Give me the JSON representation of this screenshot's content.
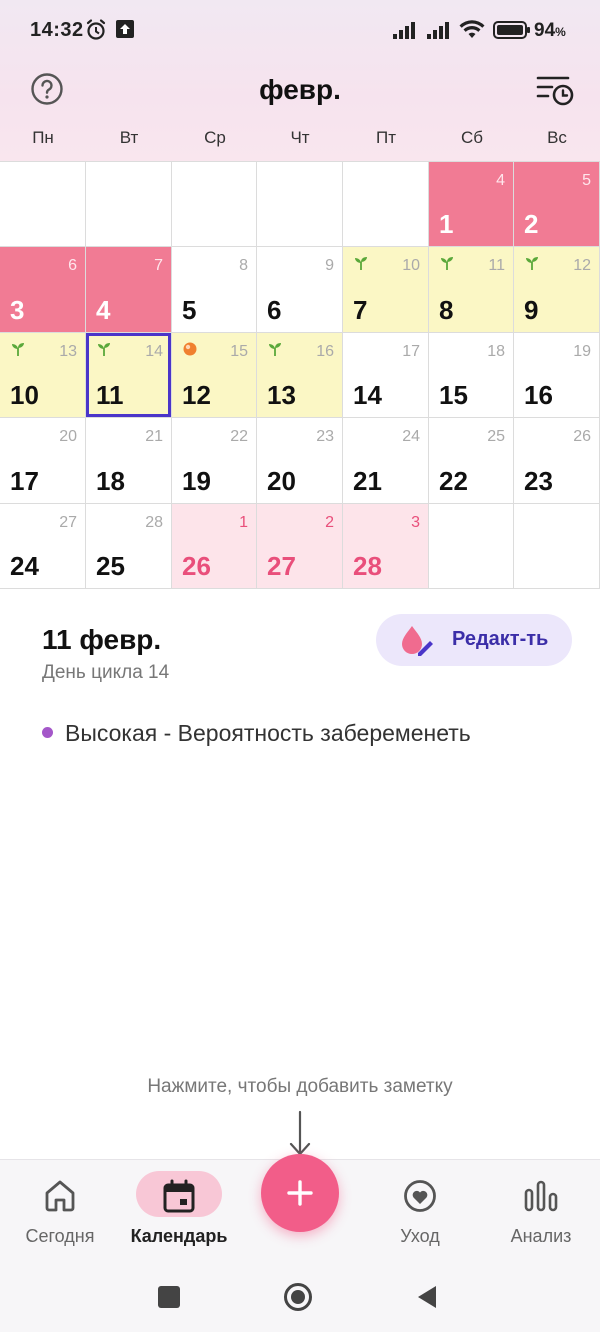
{
  "status_bar": {
    "time": "14:32",
    "battery_percent": "94",
    "battery_unit": "%",
    "icons": [
      "alarm-icon",
      "upload-icon",
      "signal-icon",
      "signal-icon",
      "wifi-icon",
      "battery-icon"
    ]
  },
  "header": {
    "month_title": "февр.",
    "help_icon": "help-circle-icon",
    "history_icon": "list-clock-icon"
  },
  "weekdays": [
    "Пн",
    "Вт",
    "Ср",
    "Чт",
    "Пт",
    "Сб",
    "Вс"
  ],
  "calendar": {
    "weeks": [
      [
        {
          "day": "",
          "cycle_day": "",
          "type": "empty",
          "marker": ""
        },
        {
          "day": "",
          "cycle_day": "",
          "type": "empty",
          "marker": ""
        },
        {
          "day": "",
          "cycle_day": "",
          "type": "empty",
          "marker": ""
        },
        {
          "day": "",
          "cycle_day": "",
          "type": "empty",
          "marker": ""
        },
        {
          "day": "",
          "cycle_day": "",
          "type": "empty",
          "marker": ""
        },
        {
          "day": "1",
          "cycle_day": "4",
          "type": "period",
          "marker": ""
        },
        {
          "day": "2",
          "cycle_day": "5",
          "type": "period",
          "marker": ""
        }
      ],
      [
        {
          "day": "3",
          "cycle_day": "6",
          "type": "period",
          "marker": ""
        },
        {
          "day": "4",
          "cycle_day": "7",
          "type": "period",
          "marker": ""
        },
        {
          "day": "5",
          "cycle_day": "8",
          "type": "normal",
          "marker": ""
        },
        {
          "day": "6",
          "cycle_day": "9",
          "type": "normal",
          "marker": ""
        },
        {
          "day": "7",
          "cycle_day": "10",
          "type": "fertile",
          "marker": "sprout"
        },
        {
          "day": "8",
          "cycle_day": "11",
          "type": "fertile",
          "marker": "sprout"
        },
        {
          "day": "9",
          "cycle_day": "12",
          "type": "fertile",
          "marker": "sprout"
        }
      ],
      [
        {
          "day": "10",
          "cycle_day": "13",
          "type": "fertile",
          "marker": "sprout"
        },
        {
          "day": "11",
          "cycle_day": "14",
          "type": "fertile",
          "marker": "sprout",
          "selected": true
        },
        {
          "day": "12",
          "cycle_day": "15",
          "type": "fertile",
          "marker": "ovulation"
        },
        {
          "day": "13",
          "cycle_day": "16",
          "type": "fertile",
          "marker": "sprout"
        },
        {
          "day": "14",
          "cycle_day": "17",
          "type": "normal",
          "marker": ""
        },
        {
          "day": "15",
          "cycle_day": "18",
          "type": "normal",
          "marker": ""
        },
        {
          "day": "16",
          "cycle_day": "19",
          "type": "normal",
          "marker": ""
        }
      ],
      [
        {
          "day": "17",
          "cycle_day": "20",
          "type": "normal",
          "marker": ""
        },
        {
          "day": "18",
          "cycle_day": "21",
          "type": "normal",
          "marker": ""
        },
        {
          "day": "19",
          "cycle_day": "22",
          "type": "normal",
          "marker": ""
        },
        {
          "day": "20",
          "cycle_day": "23",
          "type": "normal",
          "marker": ""
        },
        {
          "day": "21",
          "cycle_day": "24",
          "type": "normal",
          "marker": ""
        },
        {
          "day": "22",
          "cycle_day": "25",
          "type": "normal",
          "marker": ""
        },
        {
          "day": "23",
          "cycle_day": "26",
          "type": "normal",
          "marker": ""
        }
      ],
      [
        {
          "day": "24",
          "cycle_day": "27",
          "type": "normal",
          "marker": ""
        },
        {
          "day": "25",
          "cycle_day": "28",
          "type": "normal",
          "marker": ""
        },
        {
          "day": "26",
          "cycle_day": "1",
          "type": "predicted",
          "marker": ""
        },
        {
          "day": "27",
          "cycle_day": "2",
          "type": "predicted",
          "marker": ""
        },
        {
          "day": "28",
          "cycle_day": "3",
          "type": "predicted",
          "marker": ""
        },
        {
          "day": "",
          "cycle_day": "",
          "type": "empty",
          "marker": ""
        },
        {
          "day": "",
          "cycle_day": "",
          "type": "empty",
          "marker": ""
        }
      ]
    ],
    "colors": {
      "period": "#f17b94",
      "fertile": "#fbf7c5",
      "predicted": "#fde4ea",
      "selected_border": "#4a35c9",
      "sprout": "#5aa83a",
      "ovulation": "#f0802f"
    }
  },
  "detail": {
    "selected_date": "11 февр.",
    "cycle_day_text": "День цикла 14",
    "edit_button_label": "Редакт-ть",
    "edit_icon": "drop-pencil-icon",
    "probability_text": "Высокая - Вероятность забеременеть",
    "probability_dot_color": "#a457c9"
  },
  "hint": {
    "text": "Нажмите, чтобы добавить заметку"
  },
  "bottom_nav": {
    "items": [
      {
        "label": "Сегодня",
        "icon": "home-icon"
      },
      {
        "label": "Календарь",
        "icon": "calendar-icon",
        "active": true
      },
      {
        "label": "Уход",
        "icon": "heart-icon"
      },
      {
        "label": "Анализ",
        "icon": "bar-chart-icon"
      }
    ],
    "fab_icon": "plus-icon",
    "fab_color": "#f25d89"
  },
  "system_nav": [
    "recents-icon",
    "home-circle-icon",
    "back-icon"
  ]
}
